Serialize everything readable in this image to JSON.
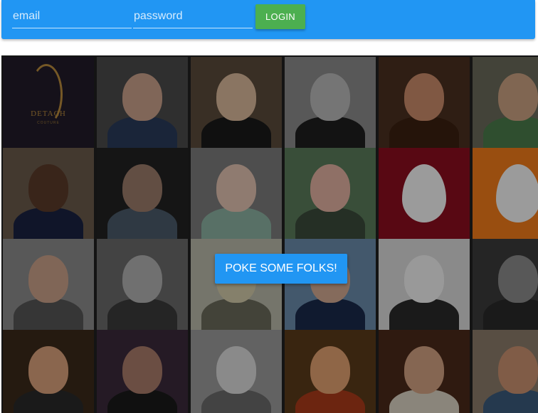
{
  "header": {
    "email_placeholder": "email",
    "password_placeholder": "password",
    "login_label": "LOGIN"
  },
  "cta": {
    "poke_label": "POKE SOME FOLKS!"
  },
  "colors": {
    "topbar": "#2196f3",
    "login_button": "#4caf50",
    "cta_button": "#2196f3"
  },
  "profile_grid": {
    "columns": 6,
    "rows": 4,
    "tiles": [
      {
        "kind": "logo",
        "bg": "#221c2a",
        "logo_text": "DETACH",
        "logo_sub": "COUTURE"
      },
      {
        "kind": "photo",
        "bg": "#4a4a4a",
        "face": "#c9a08a",
        "body": "#2a3a5a"
      },
      {
        "kind": "photo",
        "bg": "#5a4a3a",
        "face": "#d8b89a",
        "body": "#1a1a1a"
      },
      {
        "kind": "photo",
        "bg": "#8a8a8a",
        "face": "#b8b8b8",
        "body": "#1e1e1e"
      },
      {
        "kind": "photo",
        "bg": "#4a3020",
        "face": "#c88a6a",
        "body": "#3a2010"
      },
      {
        "kind": "photo",
        "bg": "#6a6a5a",
        "face": "#c8a080",
        "body": "#4a7a4a"
      },
      {
        "kind": "photo",
        "bg": "#6a5a4a",
        "face": "#5a3a2a",
        "body": "#1a2240"
      },
      {
        "kind": "photo",
        "bg": "#222222",
        "face": "#9a7a6a",
        "body": "#4a5a6a"
      },
      {
        "kind": "photo",
        "bg": "#7a7a7a",
        "face": "#e0c0b0",
        "body": "#8ab0a0"
      },
      {
        "kind": "photo",
        "bg": "#5a7a5a",
        "face": "#e0b0a0",
        "body": "#3a4a3a"
      },
      {
        "kind": "egg",
        "bg": "#8a0d1e"
      },
      {
        "kind": "egg",
        "bg": "#f07a1a"
      },
      {
        "kind": "photo",
        "bg": "#8a8a8a",
        "face": "#c8a088",
        "body": "#555555"
      },
      {
        "kind": "photo",
        "bg": "#6a6a6a",
        "face": "#b0b0b0",
        "body": "#3a3a3a"
      },
      {
        "kind": "photo",
        "bg": "#b8b8a8",
        "face": "#d0c8a8",
        "body": "#6a6a5a"
      },
      {
        "kind": "photo",
        "bg": "#6a8aaa",
        "face": "#d0a890",
        "body": "#1a2a4a"
      },
      {
        "kind": "photo",
        "bg": "#d8d8d8",
        "face": "#f0f0f0",
        "body": "#2a2a2a"
      },
      {
        "kind": "photo",
        "bg": "#3a3a3a",
        "face": "#8a8a8a",
        "body": "#2a2a2a"
      },
      {
        "kind": "photo",
        "bg": "#3a2a1a",
        "face": "#d8a07a",
        "body": "#2a2a2a"
      },
      {
        "kind": "photo",
        "bg": "#3a2a3a",
        "face": "#a87a6a",
        "body": "#1a1a1a"
      },
      {
        "kind": "photo",
        "bg": "#9a9a9a",
        "face": "#d8d8d8",
        "body": "#6a6a6a"
      },
      {
        "kind": "photo",
        "bg": "#5a3a1a",
        "face": "#e0a070",
        "body": "#aa3a1a"
      },
      {
        "kind": "photo",
        "bg": "#4a2a1a",
        "face": "#d0a080",
        "body": "#d8d0c0"
      },
      {
        "kind": "photo",
        "bg": "#8a7a6a",
        "face": "#c89070",
        "body": "#3a5a7a"
      }
    ]
  }
}
